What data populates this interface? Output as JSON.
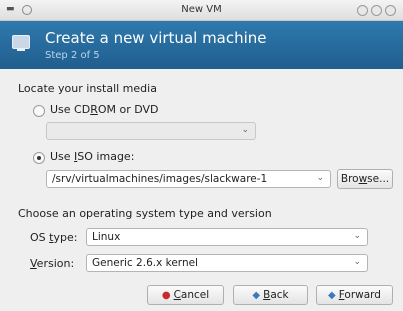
{
  "window": {
    "title": "New VM"
  },
  "header": {
    "title": "Create a new virtual machine",
    "step": "Step 2 of 5"
  },
  "install_media": {
    "heading": "Locate your install media",
    "cdrom_label_pre": "Use CD",
    "cdrom_label_ul": "R",
    "cdrom_label_post": "OM or DVD",
    "cdrom_selected": "",
    "iso_label_pre": "Use ",
    "iso_label_ul": "I",
    "iso_label_post": "SO image:",
    "iso_path": "/srv/virtualmachines/images/slackware-1",
    "browse_pre": "Bro",
    "browse_ul": "w",
    "browse_post": "se...",
    "selected_option": "iso"
  },
  "os": {
    "heading": "Choose an operating system type and version",
    "type_label_pre": "OS ",
    "type_label_ul": "t",
    "type_label_post": "ype:",
    "type_value": "Linux",
    "version_label_ul": "V",
    "version_label_post": "ersion:",
    "version_value": "Generic 2.6.x kernel"
  },
  "buttons": {
    "cancel_ul": "C",
    "cancel_post": "ancel",
    "back_ul": "B",
    "back_post": "ack",
    "forward_ul": "F",
    "forward_post": "orward"
  },
  "icons": {
    "cancel": "cancel-icon",
    "back": "back-arrow-icon",
    "forward": "forward-arrow-icon",
    "cancel_color": "#cc2a2a",
    "nav_color": "#3a78c0",
    "header_color": "#2a6fa3"
  }
}
